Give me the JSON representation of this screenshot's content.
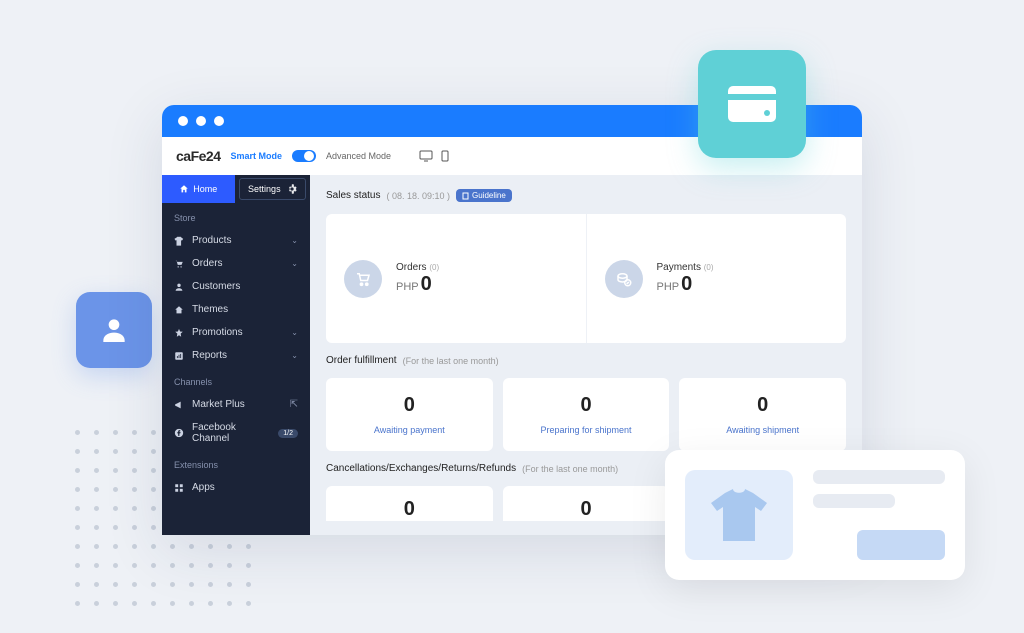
{
  "logo": "caFe24",
  "topbar": {
    "smart": "Smart Mode",
    "advanced": "Advanced Mode"
  },
  "sidebar": {
    "home": "Home",
    "settings": "Settings",
    "store_label": "Store",
    "store": [
      {
        "label": "Products"
      },
      {
        "label": "Orders"
      },
      {
        "label": "Customers"
      },
      {
        "label": "Themes"
      },
      {
        "label": "Promotions"
      },
      {
        "label": "Reports"
      }
    ],
    "channels_label": "Channels",
    "channels": [
      {
        "label": "Market Plus"
      },
      {
        "label": "Facebook Channel",
        "badge": "1/2"
      }
    ],
    "extensions_label": "Extensions",
    "extensions": [
      {
        "label": "Apps"
      }
    ]
  },
  "sales": {
    "title": "Sales status",
    "timestamp": "( 08. 18. 09:10 )",
    "guideline": "Guideline",
    "orders": {
      "label": "Orders",
      "count": "(0)",
      "currency": "PHP",
      "value": "0"
    },
    "payments": {
      "label": "Payments",
      "count": "(0)",
      "currency": "PHP",
      "value": "0"
    }
  },
  "fulfillment": {
    "title": "Order fulfillment",
    "sub": "(For the last one month)",
    "items": [
      {
        "value": "0",
        "label": "Awaiting payment"
      },
      {
        "value": "0",
        "label": "Preparing for shipment"
      },
      {
        "value": "0",
        "label": "Awaiting shipment"
      }
    ]
  },
  "cer": {
    "title": "Cancellations/Exchanges/Returns/Refunds",
    "sub": "(For the last one month)",
    "items": [
      {
        "value": "0"
      },
      {
        "value": "0"
      }
    ]
  }
}
